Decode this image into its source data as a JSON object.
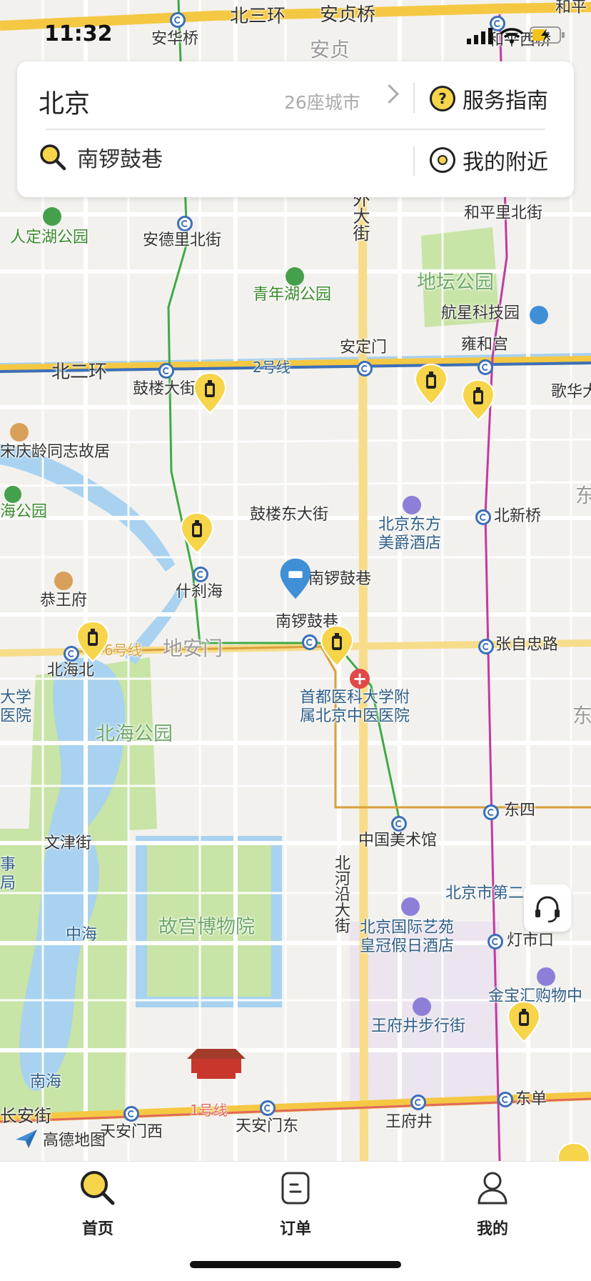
{
  "status_bar": {
    "time": "11:32"
  },
  "header": {
    "city": "北京",
    "city_count": "26座城市",
    "guide_label": "服务指南",
    "search_text": "南锣鼓巷",
    "nearby_label": "我的附近"
  },
  "map": {
    "labels": {
      "anhuaqiao": "安华桥",
      "beisanhuan": "北三环",
      "anzhenqiao": "安贞桥",
      "anzhen": "安贞",
      "heping": "和平",
      "hepingxiqiao": "和平西桥",
      "renhu": "人定湖公园",
      "andelibei": "安德里北街",
      "qingnianhu": "青年湖公园",
      "waidajie": "外大街",
      "dita": "地坛公园",
      "hepinglibei": "和平里北街",
      "hangxing": "航星科技园",
      "andingmen": "安定门",
      "yonghegong": "雍和宫",
      "beierhuan": "北二环",
      "line2": "2号线",
      "gulou_da": "鼓楼大街",
      "gehua": "歌华大",
      "song": "宋庆龄同志故居",
      "haigongyuan": "海公园",
      "guloudong": "鼓楼东大街",
      "dongfang1": "北京东方",
      "dongfang2": "美爵酒店",
      "beixinqiao": "北新桥",
      "dong1": "东",
      "gongwangfu": "恭王府",
      "shichahai": "什刹海",
      "nanluo_poi": "南锣鼓巷",
      "nanluo_st": "南锣鼓巷",
      "beihaibei": "北海北",
      "line6": "6号线",
      "dianmen": "地安门",
      "zhangzizhong": "张自忠路",
      "hosp1": "首都医科大学附",
      "hosp2": "属北京中医医院",
      "daxue": "大学",
      "yiyuan": "医院",
      "beihai": "北海公园",
      "dong2": "东",
      "dongsi": "东四",
      "wenjin": "文津街",
      "meishuguan": "中国美术馆",
      "beiheyan": "北河沿大街",
      "shi": "事",
      "ju": "局",
      "beijingdi2": "北京市第二",
      "zhonghai": "中海",
      "gugong": "故宫博物院",
      "guoji1": "北京国际艺苑",
      "guoji2": "皇冠假日酒店",
      "dengshikou": "灯市口",
      "jinbao": "金宝汇购物中",
      "wangfujing_walk": "王府井步行街",
      "nanhai": "南海",
      "changan": "长安街",
      "line1": "1号线",
      "tiananmenxi": "天安门西",
      "tiananmendong": "天安门东",
      "wangfujing": "王府井",
      "dongdan": "东单"
    }
  },
  "amap_logo": "高德地图",
  "tabbar": {
    "home": "首页",
    "orders": "订单",
    "mine": "我的"
  },
  "colors": {
    "accent": "#f7d54a",
    "ring_road": "#f5c843",
    "line2": "#3b6fb8",
    "line6": "#d9a03a",
    "line8": "#3faa45",
    "line5": "#c23aa0",
    "water": "#a8d2f0",
    "park": "#c8e4a6"
  }
}
